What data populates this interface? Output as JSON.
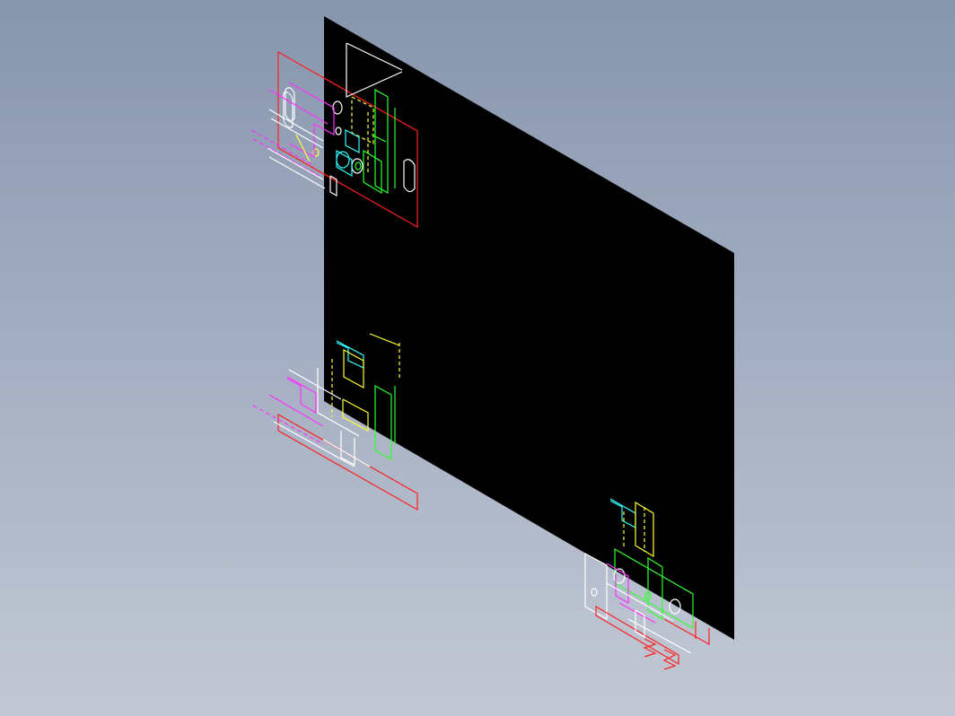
{
  "view": {
    "background_top": "#8796ae",
    "background_bottom": "#c2c8d5",
    "sheet_color": "#000000"
  },
  "colors": {
    "red": "#ff2020",
    "white": "#ffffff",
    "yellow": "#ffff30",
    "green": "#30ff30",
    "magenta": "#ff30ff",
    "cyan": "#30ffff",
    "pink": "#ff60a0"
  },
  "views": [
    "top-left-view",
    "middle-left-view",
    "bottom-right-view"
  ]
}
